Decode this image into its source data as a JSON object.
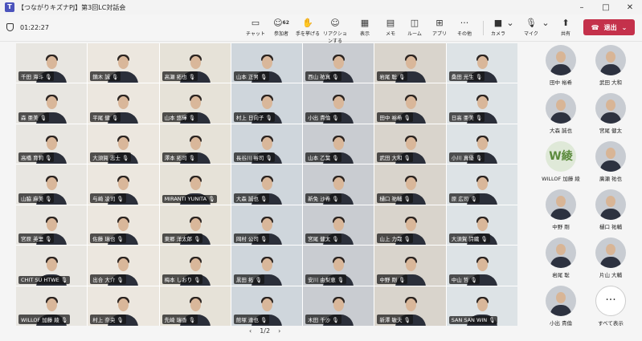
{
  "window": {
    "title": "【つながりキズナPJ】第3回LC対話会"
  },
  "toolbar": {
    "timer": "01:22:27",
    "chat": "チャット",
    "participants": "参加者",
    "participants_count": "62",
    "raise_hand": "手を挙げる",
    "reactions": "リアクションする",
    "view": "表示",
    "notes": "メモ",
    "rooms": "ルーム",
    "apps": "アプリ",
    "more": "その他",
    "camera": "カメラ",
    "mic": "マイク",
    "share": "共有",
    "leave": "退出"
  },
  "tiles": [
    "千田 海斗",
    "鏑木 誠",
    "高瀬 拓也",
    "山本 正男",
    "西山 祐真",
    "岩尾 聡",
    "桑田 光生",
    "森 亜美",
    "平尾 健",
    "山本 悠輝",
    "村上 日向子",
    "小出 貴倫",
    "田中 裕希",
    "日高 亜美",
    "高橋 育莉",
    "大須賀 志士",
    "澤本 拓司",
    "長谷川 裕司",
    "山本 乙葉",
    "武田 大和",
    "小川 真優",
    "山脇 麻美",
    "与崎 凌司",
    "MIRANTI YUNITA",
    "大森 誠也",
    "新免 沙希",
    "樋口 祐輔",
    "原 広司",
    "宮原 英里",
    "佐藤 瑞也",
    "東郷 洋太郎",
    "岡村 公司",
    "宮尾 健太",
    "山上 力哉",
    "大須賀 詩織",
    "CHIT SU HTWE",
    "出合 大介",
    "梅本 しおり",
    "黒田 拓",
    "安川 由梨恵",
    "中野 剛",
    "中山 哲",
    "WILLOF 加藤 綾",
    "村上 奈央",
    "先崎 瑞香",
    "館塚 達也",
    "木田 千沙",
    "新澤 敏夫",
    "SAN SAN WIN"
  ],
  "pager": {
    "label": "1/2"
  },
  "sidebar": [
    {
      "name": "田中 裕希",
      "initial": ""
    },
    {
      "name": "武田 大和",
      "initial": ""
    },
    {
      "name": "大森 誠也",
      "initial": ""
    },
    {
      "name": "宮尾 健太",
      "initial": ""
    },
    {
      "name": "WILLOF 加藤 綾",
      "initial": "W綾"
    },
    {
      "name": "廣瀬 祐也",
      "initial": ""
    },
    {
      "name": "中野 剛",
      "initial": ""
    },
    {
      "name": "樋口 祐輔",
      "initial": ""
    },
    {
      "name": "岩尾 聡",
      "initial": ""
    },
    {
      "name": "片山 大輔",
      "initial": ""
    },
    {
      "name": "小出 貴倫",
      "initial": ""
    },
    {
      "name": "すべて表示",
      "initial": "···"
    }
  ],
  "colors": {
    "leave": "#c4314b",
    "toolbar": "#f5f5f5",
    "accent": "#4b53bc"
  }
}
